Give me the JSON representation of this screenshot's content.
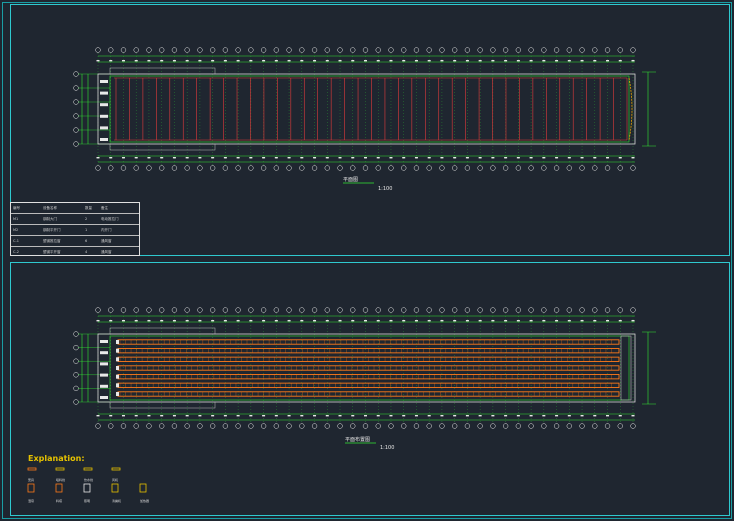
{
  "drawing": {
    "top_plan": {
      "title_label": "平面图",
      "scale_label": "1:100",
      "bays": 38,
      "frame_color": "#e23b3b",
      "grid_color": "#33e833"
    },
    "bottom_plan": {
      "title_label": "平面布置图",
      "scale_label": "1:100",
      "rows": 7,
      "cage_color": "#ff7a1a",
      "grid_color": "#33e833"
    },
    "table": {
      "rows": [
        [
          "编号",
          "设备名称",
          "数量",
          "备注"
        ],
        [
          "M1",
          "钢制大门",
          "2",
          "电动推拉门"
        ],
        [
          "M2",
          "钢制平开门",
          "1",
          "内开门"
        ],
        [
          "C-1",
          "塑钢推拉窗",
          "6",
          "通风窗"
        ],
        [
          "C-2",
          "塑钢平开窗",
          "4",
          "通风窗"
        ]
      ]
    },
    "legend": {
      "title": "Explanation:",
      "items": [
        {
          "label": "笼具",
          "icon": "cage-icon"
        },
        {
          "label": "喂料线",
          "icon": "feed-line-icon"
        },
        {
          "label": "饮水线",
          "icon": "water-line-icon"
        },
        {
          "label": "风机",
          "icon": "fan-icon"
        },
        {
          "label": "湿帘",
          "icon": "pad-icon"
        },
        {
          "label": "料塔",
          "icon": "silo-icon"
        },
        {
          "label": "照明",
          "icon": "light-icon"
        },
        {
          "label": "清粪机",
          "icon": "cleaner-icon"
        },
        {
          "label": "加热器",
          "icon": "heater-icon"
        }
      ]
    }
  }
}
